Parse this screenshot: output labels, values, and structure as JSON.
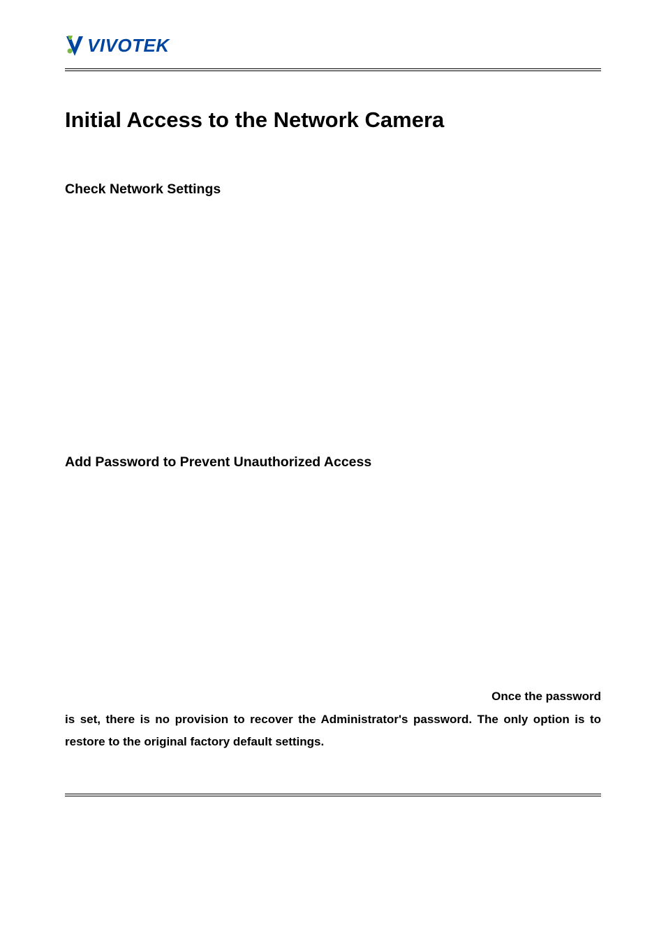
{
  "logo": {
    "brand": "VIVOTEK"
  },
  "document": {
    "title": "Initial Access to the Network Camera",
    "section1": {
      "heading": "Check Network Settings"
    },
    "section2": {
      "heading": "Add Password to Prevent Unauthorized Access",
      "warning_lead": "Once the password",
      "warning_body": "is set, there is no provision to recover the Administrator's password.   The only option is to restore to the original factory default settings."
    }
  }
}
